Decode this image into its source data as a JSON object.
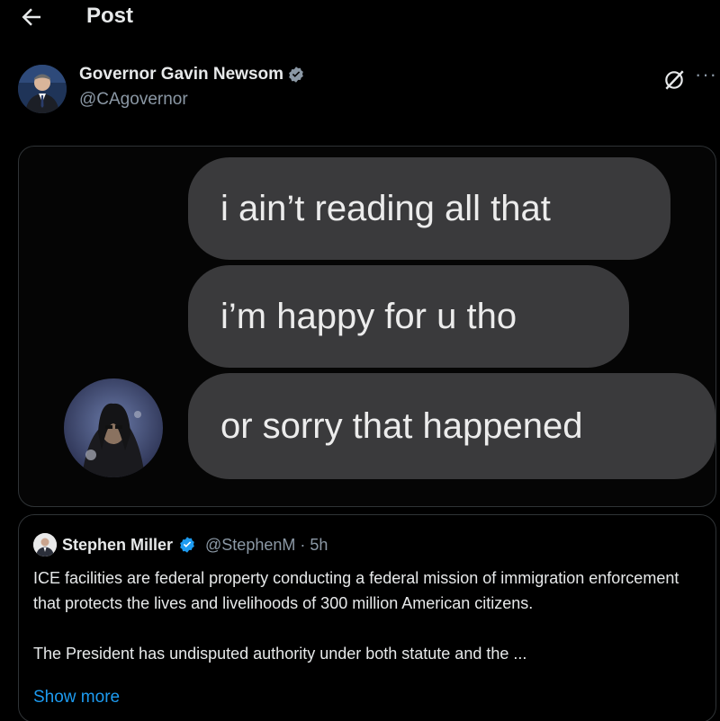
{
  "topbar": {
    "title": "Post",
    "back_icon": "arrow-left-icon"
  },
  "author": {
    "name": "Governor Gavin Newsom",
    "handle": "@CAgovernor",
    "verified": true,
    "verified_color": "#8b98a5",
    "more_label": "···"
  },
  "media": {
    "messages": [
      "i ain’t reading all that",
      "i’m happy for u tho",
      "or sorry that happened"
    ],
    "bubble_color": "#3a3a3c"
  },
  "quote": {
    "name": "Stephen Miller",
    "handle_time": "@StephenM · 5h",
    "verified_color": "#1d9bf0",
    "paragraphs": [
      "ICE facilities are federal property conducting a federal mission of immigration enforcement that protects the lives and livelihoods of 300 million American citizens.",
      "The President has undisputed authority under both statute and the ..."
    ],
    "show_more": "Show more"
  },
  "colors": {
    "background": "#000000",
    "text_primary": "#e7e9ea",
    "text_secondary": "#8b98a5",
    "link": "#1d9bf0",
    "border": "#2f3336"
  }
}
